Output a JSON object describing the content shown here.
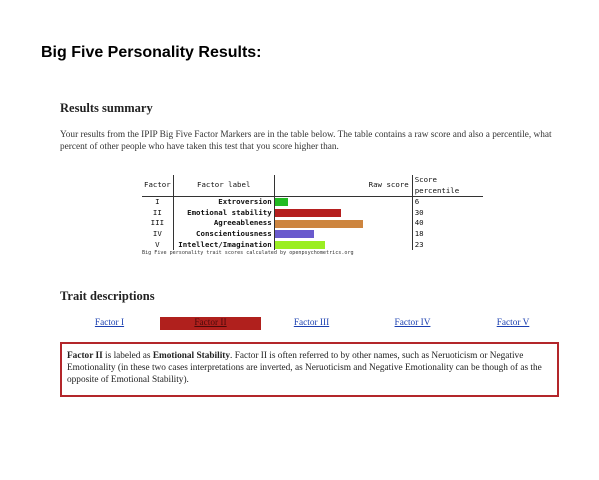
{
  "page_title": "Big Five Personality Results:",
  "summary": {
    "heading": "Results summary",
    "text": "Your results from the IPIP Big Five Factor Markers are in the table below. The table contains a raw score and also a percentile, what percent of other people who have taken this test that you score higher than."
  },
  "results_table": {
    "headers": {
      "factor": "Factor",
      "label": "Factor label",
      "raw": "Raw score",
      "percentile": "Score percentile"
    },
    "rows": [
      {
        "factor": "I",
        "label": "Extroversion",
        "percentile": "6",
        "value": 6,
        "color": "#22bb22"
      },
      {
        "factor": "II",
        "label": "Emotional stability",
        "percentile": "30",
        "value": 30,
        "color": "#b51f1f"
      },
      {
        "factor": "III",
        "label": "Agreeableness",
        "percentile": "40",
        "value": 40,
        "color": "#cd853f"
      },
      {
        "factor": "IV",
        "label": "Conscientiousness",
        "percentile": "18",
        "value": 18,
        "color": "#6a5acd"
      },
      {
        "factor": "V",
        "label": "Intellect/Imagination",
        "percentile": "23",
        "value": 23,
        "color": "#9aee22"
      }
    ],
    "caption": "Big Five personality trait scores calculated by openpsychometrics.org"
  },
  "traits": {
    "heading": "Trait descriptions",
    "tabs": [
      {
        "label": "Factor I",
        "active": false
      },
      {
        "label": "Factor II",
        "active": true
      },
      {
        "label": "Factor III",
        "active": false
      },
      {
        "label": "Factor IV",
        "active": false
      },
      {
        "label": "Factor V",
        "active": false
      }
    ],
    "description": {
      "prefix_bold": "Factor II",
      "part1": " is labeled as ",
      "label_bold": "Emotional Stability",
      "part2": ". Factor II is often referred to by other names, such as Neruoticism or Negative Emotionality (in these two cases interpretations are inverted, as Neruoticism and Negative Emotionality can be though of as the opposite of Emotional Stability)."
    }
  }
}
